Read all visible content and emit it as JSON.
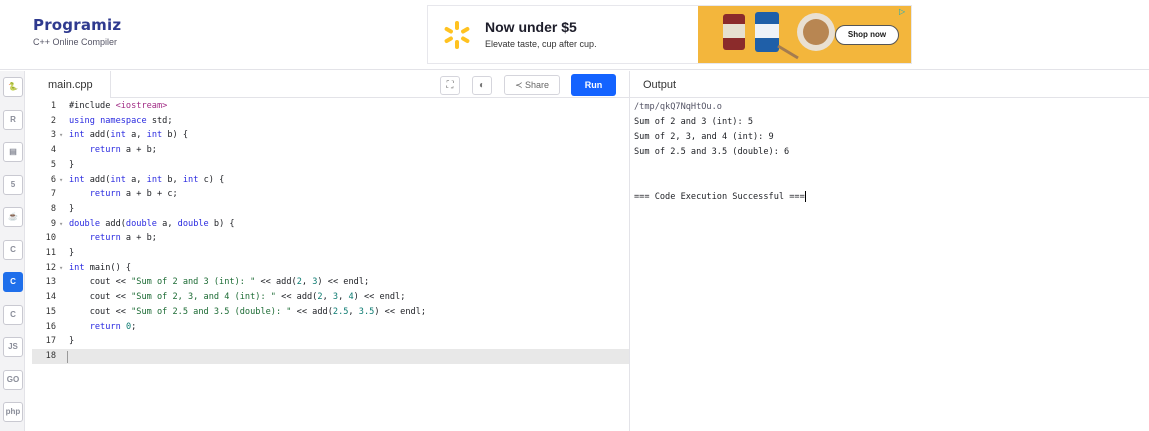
{
  "brand": {
    "name": "Programiz",
    "subtitle": "C++ Online Compiler"
  },
  "ad": {
    "title": "Now under $5",
    "subtitle": "Elevate taste, cup after cup.",
    "button": "Shop now",
    "accent": "#f3b63c"
  },
  "sidebar": {
    "languages": [
      {
        "name": "python",
        "icon": "python-icon",
        "glyph": "🐍"
      },
      {
        "name": "r",
        "icon": "r-icon",
        "glyph": "R"
      },
      {
        "name": "sql",
        "icon": "database-icon",
        "glyph": "▤"
      },
      {
        "name": "html",
        "icon": "html5-icon",
        "glyph": "5"
      },
      {
        "name": "java",
        "icon": "java-icon",
        "glyph": "☕"
      },
      {
        "name": "c",
        "icon": "c-icon",
        "glyph": "C"
      },
      {
        "name": "cpp",
        "icon": "cpp-icon",
        "glyph": "C",
        "active": true
      },
      {
        "name": "csharp",
        "icon": "csharp-icon",
        "glyph": "C"
      },
      {
        "name": "js",
        "icon": "js-icon",
        "glyph": "JS"
      },
      {
        "name": "go",
        "icon": "go-icon",
        "glyph": "GO"
      },
      {
        "name": "php",
        "icon": "php-icon",
        "glyph": "php"
      }
    ]
  },
  "editor": {
    "filename": "main.cpp",
    "share_label": "Share",
    "run_label": "Run",
    "lines": [
      "#include <iostream>",
      "using namespace std;",
      "int add(int a, int b) {",
      "    return a + b;",
      "}",
      "int add(int a, int b, int c) {",
      "    return a + b + c;",
      "}",
      "double add(double a, double b) {",
      "    return a + b;",
      "}",
      "int main() {",
      "    cout << \"Sum of 2 and 3 (int): \" << add(2, 3) << endl;",
      "    cout << \"Sum of 2, 3, and 4 (int): \" << add(2, 3, 4) << endl;",
      "    cout << \"Sum of 2.5 and 3.5 (double): \" << add(2.5, 3.5) << endl;",
      "    return 0;",
      "}",
      ""
    ]
  },
  "output": {
    "title": "Output",
    "path": "/tmp/qkQ7NqHtOu.o",
    "lines": [
      "Sum of 2 and 3 (int): 5",
      "Sum of 2, 3, and 4 (int): 9",
      "Sum of 2.5 and 3.5 (double): 6",
      "",
      "",
      "=== Code Execution Successful ==="
    ]
  }
}
